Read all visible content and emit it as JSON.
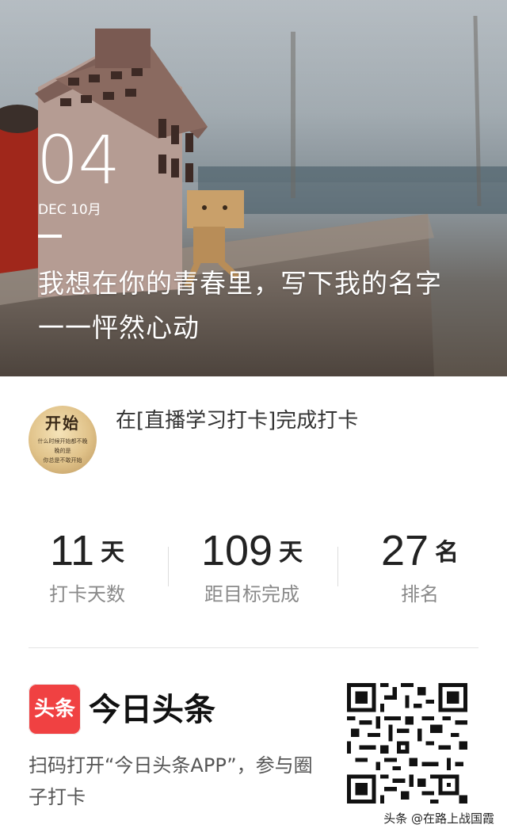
{
  "hero": {
    "day": "04",
    "month": "DEC 10月",
    "quote": "我想在你的青春里，写下我的名字 一一怦然心动"
  },
  "checkin": {
    "avatar_title": "开始",
    "avatar_lines": [
      "什么时候开始都不晚",
      "晚的是",
      "你总是不敢开始"
    ],
    "text": "在[直播学习打卡]完成打卡"
  },
  "stats": [
    {
      "value": "11",
      "unit": "天",
      "caption": "打卡天数"
    },
    {
      "value": "109",
      "unit": "天",
      "caption": "距目标完成"
    },
    {
      "value": "27",
      "unit": "名",
      "caption": "排名"
    }
  ],
  "footer": {
    "logo_text": "头条",
    "app_name": "今日头条",
    "hint": "扫码打开“今日头条APP”，参与圈子打卡",
    "qr_icon": "qr-code-icon"
  },
  "watermark": "头条 @在路上战国霞",
  "colors": {
    "logo_red": "#f04142",
    "text_dark": "#222222",
    "caption_gray": "#8a8a8a"
  }
}
